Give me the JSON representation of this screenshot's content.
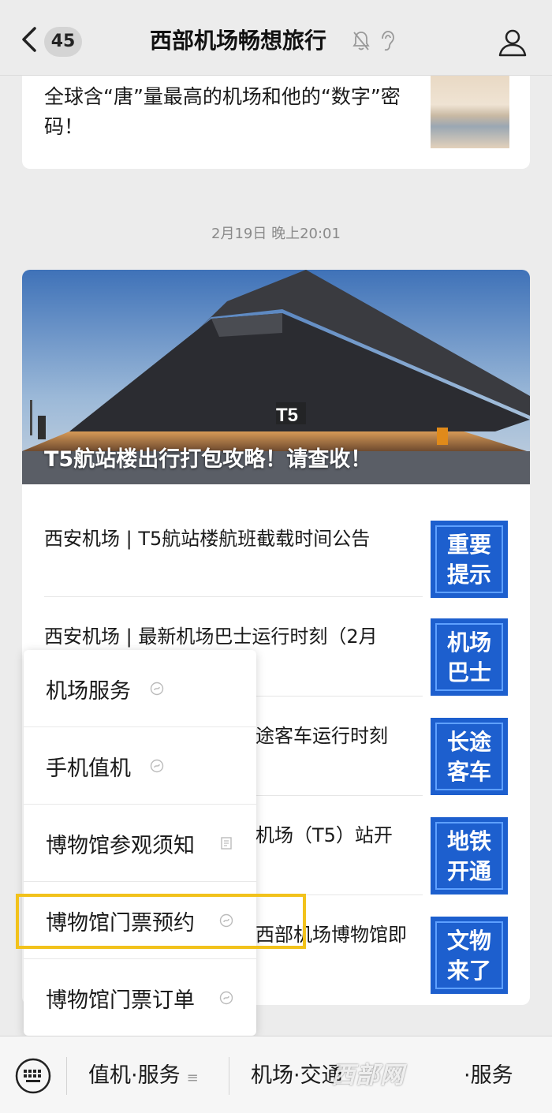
{
  "header": {
    "unread_count": "45",
    "title": "西部机场畅想旅行"
  },
  "top_card": {
    "text": "全球含“唐”量最高的机场和他的“数字”密码！"
  },
  "timestamp": "2月19日 晚上20:01",
  "main_card": {
    "hero_title": "T5航站楼出行打包攻略！请查收！",
    "hero_sign": "T5",
    "articles": [
      {
        "text": "西安机场 | T5航站楼航班截载时间公告",
        "thumb_line1": "重要",
        "thumb_line2": "提示"
      },
      {
        "text": "西安机场 | 最新机场巴士运行时刻（2月",
        "thumb_line1": "机场",
        "thumb_line2": "巴士"
      },
      {
        "text": "途客车运行时刻",
        "thumb_line1": "长途",
        "thumb_line2": "客车"
      },
      {
        "text": "机场（T5）站开",
        "thumb_line1": "地铁",
        "thumb_line2": "开通"
      },
      {
        "text": "西部机场博物馆即",
        "thumb_line1": "文物",
        "thumb_line2": "来了"
      }
    ]
  },
  "menu": {
    "items": [
      {
        "label": "机场服务",
        "icon": "mini-program-icon"
      },
      {
        "label": "手机值机",
        "icon": "mini-program-icon"
      },
      {
        "label": "博物馆参观须知",
        "icon": "article-icon"
      },
      {
        "label": "博物馆门票预约",
        "icon": "mini-program-icon"
      },
      {
        "label": "博物馆门票订单",
        "icon": "mini-program-icon"
      }
    ],
    "highlight_color": "#f2c21b"
  },
  "bottom_bar": {
    "tab1": "值机·服务",
    "tab2": "机场·交通",
    "tab3": "·服务",
    "watermark": "西部网"
  },
  "colors": {
    "thumb_blue": "#1d5fce",
    "background": "#ececec"
  }
}
